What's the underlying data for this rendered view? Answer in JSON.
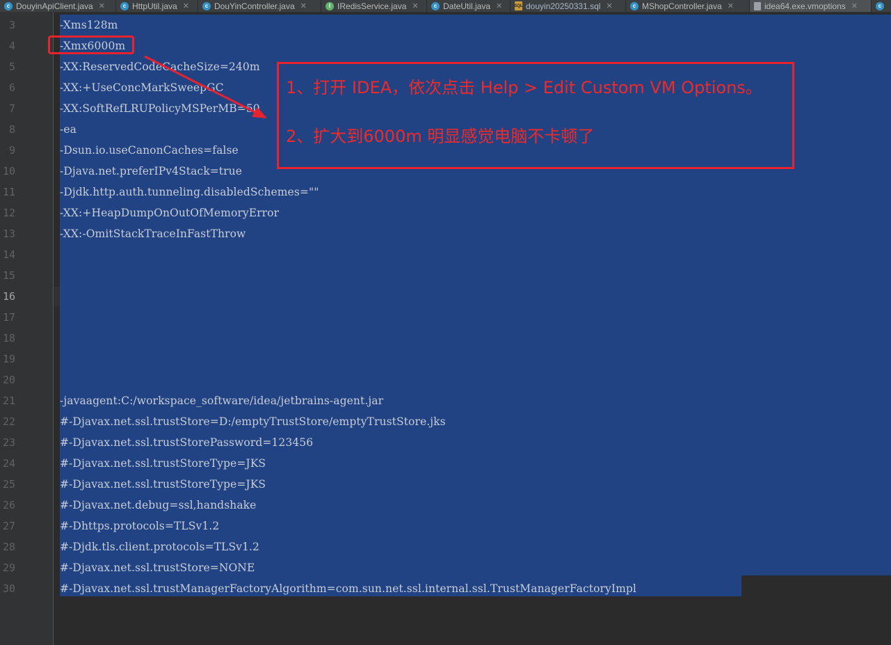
{
  "tabs": [
    {
      "label": "DouyinApiClient.java",
      "icon": "class-icon"
    },
    {
      "label": "HttpUtil.java",
      "icon": "class-icon"
    },
    {
      "label": "DouYinController.java",
      "icon": "class-icon"
    },
    {
      "label": "IRedisService.java",
      "icon": "class-icon"
    },
    {
      "label": "DateUtil.java",
      "icon": "class-icon"
    },
    {
      "label": "douyin20250331.sql",
      "icon": "sql-file-icon"
    },
    {
      "label": "MShopController.java",
      "icon": "class-icon"
    },
    {
      "label": "idea64.exe.vmoptions",
      "icon": "file-icon",
      "active": true
    }
  ],
  "editor": {
    "current_line": 16,
    "lines": [
      {
        "no": "3",
        "text": "-Xms128m"
      },
      {
        "no": "4",
        "text": "-Xmx6000m"
      },
      {
        "no": "5",
        "text": "-XX:ReservedCodeCacheSize=240m"
      },
      {
        "no": "6",
        "text": "-XX:+UseConcMarkSweepGC"
      },
      {
        "no": "7",
        "text": "-XX:SoftRefLRUPolicyMSPerMB=50"
      },
      {
        "no": "8",
        "text": "-ea"
      },
      {
        "no": "9",
        "text": "-Dsun.io.useCanonCaches=false"
      },
      {
        "no": "10",
        "text": "-Djava.net.preferIPv4Stack=true"
      },
      {
        "no": "11",
        "text": "-Djdk.http.auth.tunneling.disabledSchemes=\"\""
      },
      {
        "no": "12",
        "text": "-XX:+HeapDumpOnOutOfMemoryError"
      },
      {
        "no": "13",
        "text": "-XX:-OmitStackTraceInFastThrow"
      },
      {
        "no": "14",
        "text": ""
      },
      {
        "no": "15",
        "text": ""
      },
      {
        "no": "16",
        "text": ""
      },
      {
        "no": "17",
        "text": ""
      },
      {
        "no": "18",
        "text": ""
      },
      {
        "no": "19",
        "text": ""
      },
      {
        "no": "20",
        "text": ""
      },
      {
        "no": "21",
        "text": "-javaagent:C:/workspace_software/idea/jetbrains-agent.jar"
      },
      {
        "no": "22",
        "text": "#-Djavax.net.ssl.trustStore=D:/emptyTrustStore/emptyTrustStore.jks"
      },
      {
        "no": "23",
        "text": "#-Djavax.net.ssl.trustStorePassword=123456"
      },
      {
        "no": "24",
        "text": "#-Djavax.net.ssl.trustStoreType=JKS"
      },
      {
        "no": "25",
        "text": "#-Djavax.net.ssl.trustStoreType=JKS"
      },
      {
        "no": "26",
        "text": "#-Djavax.net.debug=ssl,handshake"
      },
      {
        "no": "27",
        "text": "#-Dhttps.protocols=TLSv1.2"
      },
      {
        "no": "28",
        "text": "#-Djdk.tls.client.protocols=TLSv1.2"
      },
      {
        "no": "29",
        "text": "#-Djavax.net.ssl.trustStore=NONE"
      },
      {
        "no": "30",
        "text": "#-Djavax.net.ssl.trustManagerFactoryAlgorithm=com.sun.net.ssl.internal.ssl.TrustManagerFactoryImpl"
      }
    ]
  },
  "annotation": {
    "step1": "1、打开 IDEA，依次点击 Help > Edit Custom VM Options。",
    "step2": "2、扩大到6000m  明显感觉电脑不卡顿了",
    "color": "#e8232e"
  },
  "colors": {
    "selection": "#214283",
    "editor_bg": "#2b2b2b",
    "gutter_bg": "#313335",
    "tabbar_bg": "#3c3f41"
  }
}
